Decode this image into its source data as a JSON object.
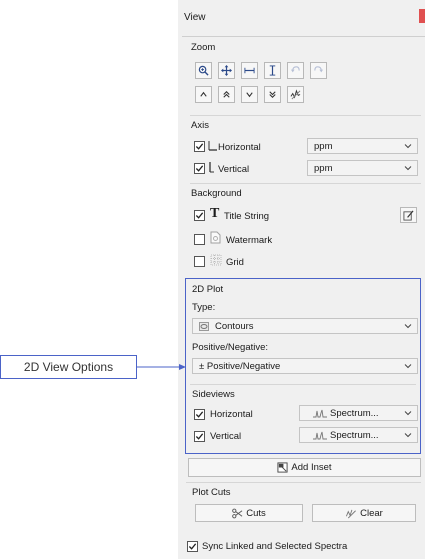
{
  "window": {
    "title": "View"
  },
  "zoom": {
    "title": "Zoom"
  },
  "axis": {
    "title": "Axis",
    "horizontal": {
      "label": "Horizontal",
      "checked": true,
      "unit": "ppm"
    },
    "vertical": {
      "label": "Vertical",
      "checked": true,
      "unit": "ppm"
    }
  },
  "background": {
    "title": "Background",
    "items": [
      {
        "label": "Title String",
        "checked": true
      },
      {
        "label": "Watermark",
        "checked": false
      },
      {
        "label": "Grid",
        "checked": false
      }
    ]
  },
  "plot2d": {
    "title": "2D Plot",
    "type_label": "Type:",
    "type_value": "Contours",
    "posneg_label": "Positive/Negative:",
    "posneg_value": "± Positive/Negative",
    "sideviews": {
      "title": "Sideviews",
      "horizontal": {
        "label": "Horizontal",
        "checked": true,
        "value": "Spectrum..."
      },
      "vertical": {
        "label": "Vertical",
        "checked": true,
        "value": "Spectrum..."
      }
    }
  },
  "add_inset_label": "Add Inset",
  "plot_cuts": {
    "title": "Plot Cuts",
    "cuts_label": "Cuts",
    "clear_label": "Clear"
  },
  "sync": {
    "label": "Sync Linked and Selected Spectra",
    "checked": true
  },
  "annotation": {
    "label": "2D View Options"
  },
  "colors": {
    "highlight": "#4b63c8",
    "panel": "#f0f0f0"
  }
}
